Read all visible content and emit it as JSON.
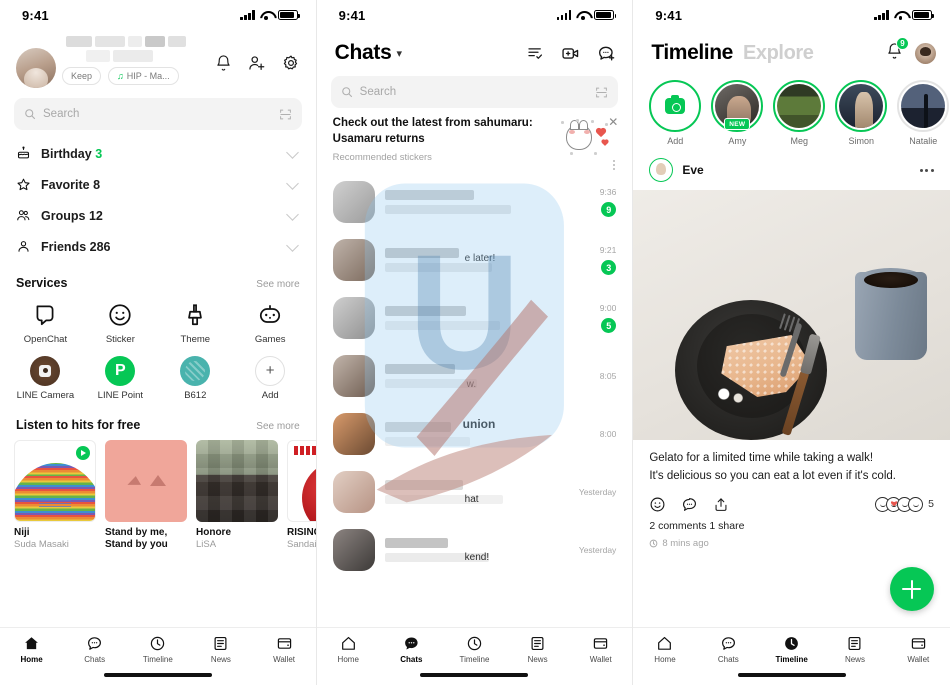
{
  "status_bar": {
    "time": "9:41"
  },
  "panel_home": {
    "profile": {
      "keep_label": "Keep",
      "music_chip": "HIP - Ma...",
      "music_icon": "music-note-icon"
    },
    "header_icons": [
      "bell-icon",
      "add-friend-icon",
      "gear-icon"
    ],
    "search": {
      "placeholder": "Search",
      "scan_icon": "qr-scan-icon"
    },
    "nav_items": [
      {
        "icon": "birthday-cake-icon",
        "label": "Birthday",
        "count": "3",
        "count_green": true
      },
      {
        "icon": "star-icon",
        "label": "Favorite",
        "count": "8",
        "count_green": false
      },
      {
        "icon": "groups-icon",
        "label": "Groups",
        "count": "12",
        "count_green": false
      },
      {
        "icon": "person-icon",
        "label": "Friends",
        "count": "286",
        "count_green": false
      }
    ],
    "services": {
      "title": "Services",
      "see_more": "See more",
      "items": [
        {
          "label": "OpenChat",
          "icon": "openchat-icon"
        },
        {
          "label": "Sticker",
          "icon": "sticker-smiley-icon"
        },
        {
          "label": "Theme",
          "icon": "theme-brush-icon"
        },
        {
          "label": "Games",
          "icon": "games-robot-icon"
        },
        {
          "label": "LINE Camera",
          "icon": "line-camera-icon"
        },
        {
          "label": "LINE Point",
          "icon": "line-point-icon"
        },
        {
          "label": "B612",
          "icon": "b612-icon"
        },
        {
          "label": "Add",
          "icon": "plus-icon"
        }
      ]
    },
    "music": {
      "title": "Listen to hits for free",
      "see_more": "See more",
      "tracks": [
        {
          "title": "Niji",
          "artist": "Suda Masaki"
        },
        {
          "title": "Stand by me, Stand by you",
          "artist": ""
        },
        {
          "title": "Honore",
          "artist": "LiSA"
        },
        {
          "title": "RISING S",
          "artist": "Sandaime"
        }
      ]
    },
    "tabs": [
      {
        "label": "Home",
        "icon": "home-icon",
        "active": true
      },
      {
        "label": "Chats",
        "icon": "chat-icon",
        "active": false
      },
      {
        "label": "Timeline",
        "icon": "clock-icon",
        "active": false
      },
      {
        "label": "News",
        "icon": "news-icon",
        "active": false
      },
      {
        "label": "Wallet",
        "icon": "wallet-icon",
        "active": false
      }
    ]
  },
  "panel_chats": {
    "title": "Chats",
    "caret": "chevron-down-icon",
    "header_icons": [
      "select-list-icon",
      "video-call-icon",
      "new-chat-icon"
    ],
    "search": {
      "placeholder": "Search",
      "scan_icon": "qr-scan-icon"
    },
    "promo": {
      "title": "Check out the latest from sahumaru: Usamaru returns",
      "subtitle": "Recommended stickers",
      "close_icon": "close-icon",
      "more_icon": "kebab-menu-icon"
    },
    "rows": [
      {
        "time": "9:36",
        "badge": "9",
        "snippet": ""
      },
      {
        "time": "9:21",
        "badge": "3",
        "snippet": "e later!"
      },
      {
        "time": "9:00",
        "badge": "5",
        "snippet": ""
      },
      {
        "time": "8:05",
        "badge": "",
        "snippet": "w."
      },
      {
        "time": "8:00",
        "badge": "",
        "snippet": "union"
      },
      {
        "time": "Yesterday",
        "badge": "",
        "snippet": "hat"
      },
      {
        "time": "Yesterday",
        "badge": "",
        "snippet": "kend!"
      }
    ],
    "tabs": [
      {
        "label": "Home",
        "icon": "home-icon",
        "active": false
      },
      {
        "label": "Chats",
        "icon": "chat-icon",
        "active": true
      },
      {
        "label": "Timeline",
        "icon": "clock-icon",
        "active": false
      },
      {
        "label": "News",
        "icon": "news-icon",
        "active": false
      },
      {
        "label": "Wallet",
        "icon": "wallet-icon",
        "active": false
      }
    ]
  },
  "panel_timeline": {
    "tab_active": "Timeline",
    "tab_inactive": "Explore",
    "bell_badge": "9",
    "stories": [
      {
        "name": "Add",
        "type": "add",
        "ring": "on",
        "new": false
      },
      {
        "name": "Amy",
        "type": "amy",
        "ring": "on",
        "new": true,
        "new_label": "NEW"
      },
      {
        "name": "Meg",
        "type": "meg",
        "ring": "on",
        "new": false
      },
      {
        "name": "Simon",
        "type": "simon",
        "ring": "on",
        "new": false
      },
      {
        "name": "Natalie",
        "type": "nat",
        "ring": "off",
        "new": false
      },
      {
        "name": "",
        "type": "part",
        "ring": "off",
        "new": false
      }
    ],
    "post": {
      "author": "Eve",
      "more_icon": "kebab-menu-icon",
      "text_line1": "Gelato for a limited time while taking a walk!",
      "text_line2": "It's delicious so you can eat a lot even if it's cold.",
      "actions": [
        "like-smiley-icon",
        "comment-icon",
        "share-icon"
      ],
      "reaction_count": "5",
      "meta": "2 comments  1 share",
      "timestamp": "8 mins ago",
      "clock_icon": "clock-small-icon"
    },
    "fab_icon": "plus-icon",
    "tabs": [
      {
        "label": "Home",
        "icon": "home-icon",
        "active": false
      },
      {
        "label": "Chats",
        "icon": "chat-icon",
        "active": false
      },
      {
        "label": "Timeline",
        "icon": "clock-icon",
        "active": true
      },
      {
        "label": "News",
        "icon": "news-icon",
        "active": false
      },
      {
        "label": "Wallet",
        "icon": "wallet-icon",
        "active": false
      }
    ]
  },
  "colors": {
    "brand_green": "#06c755",
    "text": "#111111",
    "muted": "#a5a5a5"
  }
}
